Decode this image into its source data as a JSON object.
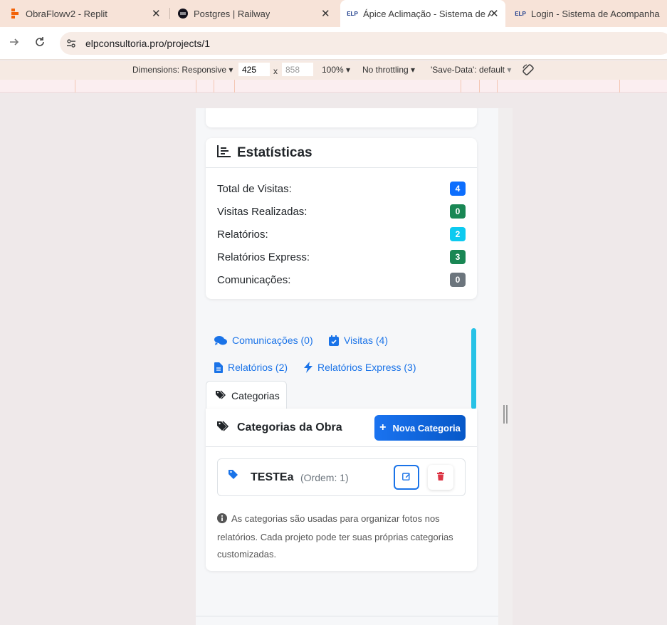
{
  "tabs": [
    {
      "title": "ObraFlowv2 - Replit",
      "favicon": "replit-icon",
      "active": false
    },
    {
      "title": "Postgres | Railway",
      "favicon": "railway-icon",
      "active": false
    },
    {
      "title": "Ápice Aclimação - Sistema de A",
      "favicon": "elp-icon",
      "active": true
    },
    {
      "title": "Login - Sistema de Acompanha",
      "favicon": "elp-icon",
      "active": false
    }
  ],
  "favicon_text": "ELP",
  "close_glyph": "✕",
  "address": {
    "url": "elpconsultoria.pro/projects/1"
  },
  "devtools": {
    "dimensions_label": "Dimensions: Responsive",
    "width": "425",
    "height": "858",
    "times": "x",
    "zoom": "100%",
    "throttling": "No throttling",
    "save_data": "'Save-Data': default"
  },
  "stats": {
    "title": "Estatísticas",
    "rows": [
      {
        "label": "Total de Visitas:",
        "value": "4",
        "color": "#0d6efd"
      },
      {
        "label": "Visitas Realizadas:",
        "value": "0",
        "color": "#198754"
      },
      {
        "label": "Relatórios:",
        "value": "2",
        "color": "#0dcaf0"
      },
      {
        "label": "Relatórios Express:",
        "value": "3",
        "color": "#198754"
      },
      {
        "label": "Comunicações:",
        "value": "0",
        "color": "#6c757d"
      }
    ]
  },
  "nav_tabs": {
    "comunicacoes": "Comunicações (0)",
    "visitas": "Visitas (4)",
    "relatorios": "Relatórios (2)",
    "relatorios_express": "Relatórios Express (3)",
    "categorias": "Categorias"
  },
  "categories": {
    "title": "Categorias da Obra",
    "new_button": "Nova Categoria",
    "items": [
      {
        "name": "TESTEa",
        "order": "(Ordem: 1)"
      }
    ],
    "info": "As categorias são usadas para organizar fotos nos relatórios. Cada projeto pode ter suas próprias categorias customizadas."
  },
  "colors": {
    "primary": "#1a73e8",
    "danger": "#dc3545",
    "accent_scroll": "#27c2e6"
  }
}
